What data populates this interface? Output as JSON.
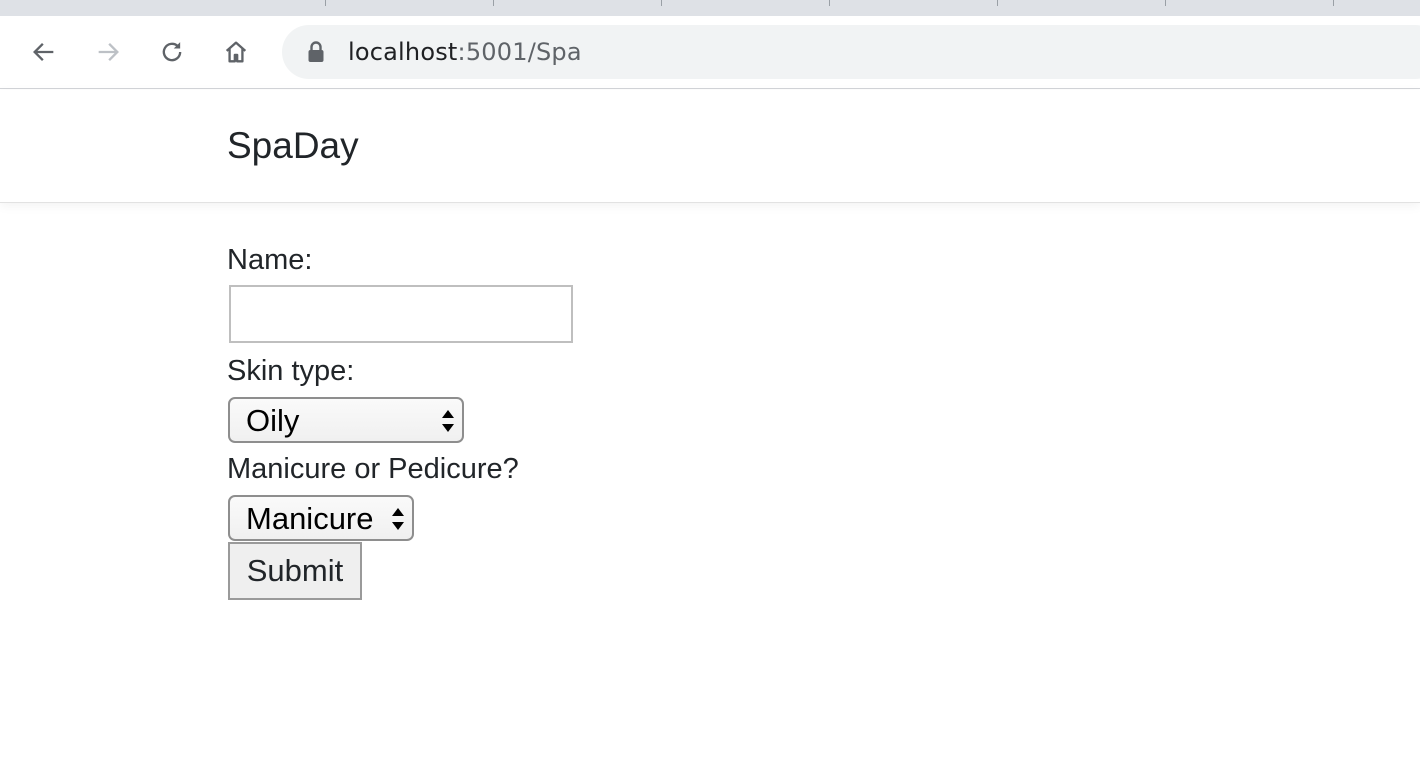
{
  "browser": {
    "url_host": "localhost",
    "url_rest": ":5001/Spa",
    "icons": [
      "back-icon",
      "forward-icon",
      "reload-icon",
      "home-icon",
      "lock-icon"
    ]
  },
  "navbar": {
    "brand": "SpaDay"
  },
  "form": {
    "name_label": "Name:",
    "name_value": "",
    "skin_label": "Skin type:",
    "skin_selected": "Oily",
    "service_label": "Manicure or Pedicure?",
    "service_selected": "Manicure",
    "submit_label": "Submit"
  },
  "colors": {
    "text": "#212529",
    "chrome_bg": "#dee1e6",
    "omnibox_bg": "#f1f3f4"
  }
}
